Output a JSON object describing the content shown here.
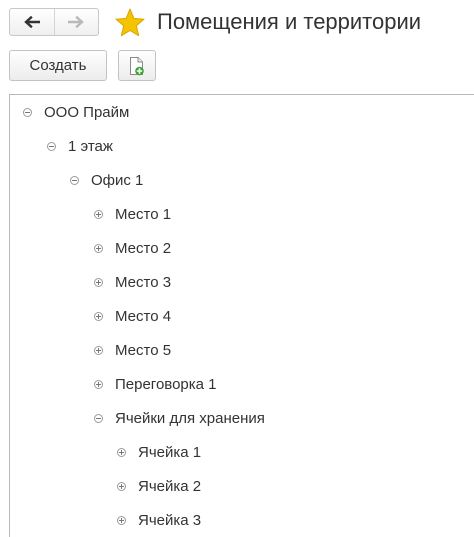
{
  "header": {
    "title": "Помещения и территории",
    "back_icon": "arrow-left-icon",
    "forward_icon": "arrow-right-icon",
    "favorite_icon": "star-icon",
    "favorite_color": "#f5c400"
  },
  "toolbar": {
    "create_label": "Создать",
    "add_doc_icon": "document-add-icon"
  },
  "tree": {
    "items": [
      {
        "label": "ООО Прайм",
        "expanded": true
      },
      {
        "label": "1 этаж",
        "expanded": true
      },
      {
        "label": "Офис 1",
        "expanded": true
      },
      {
        "label": "Место 1",
        "expanded": false
      },
      {
        "label": "Место 2",
        "expanded": false
      },
      {
        "label": "Место 3",
        "expanded": false
      },
      {
        "label": "Место 4",
        "expanded": false
      },
      {
        "label": "Место 5",
        "expanded": false
      },
      {
        "label": "Переговорка 1",
        "expanded": false
      },
      {
        "label": "Ячейки для хранения",
        "expanded": true
      },
      {
        "label": "Ячейка 1",
        "expanded": false
      },
      {
        "label": "Ячейка 2",
        "expanded": false
      },
      {
        "label": "Ячейка 3",
        "expanded": false
      }
    ]
  }
}
